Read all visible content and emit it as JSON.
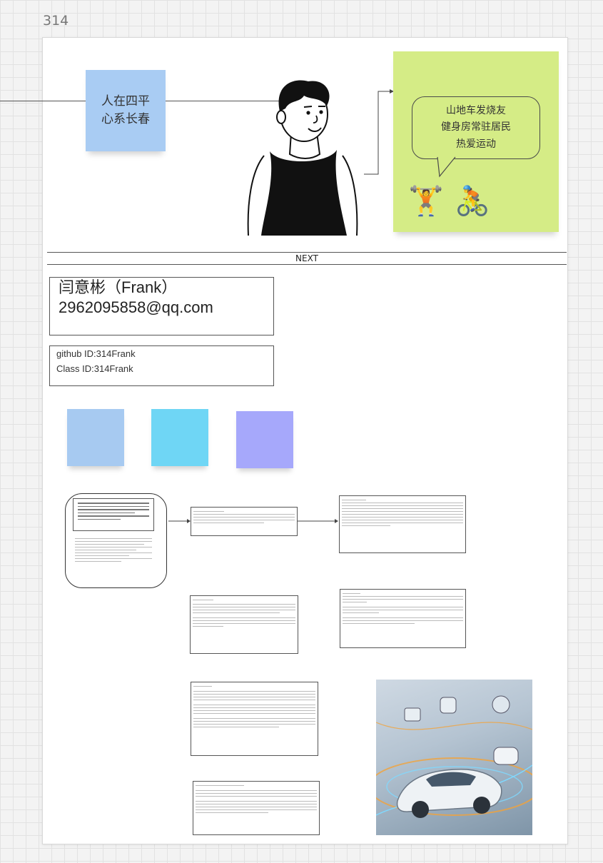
{
  "page_number": "314",
  "sticky_note": {
    "line1": "人在四平",
    "line2": "心系长春"
  },
  "speech_bubble": {
    "line1": "山地车发烧友",
    "line2": "健身房常驻居民",
    "line3": "热爱运动"
  },
  "emojis": {
    "weightlifter": "🏋️",
    "cyclist": "🚴"
  },
  "divider_label": "NEXT",
  "profile": {
    "name": "闫意彬（Frank）",
    "email": "2962095858@qq.com",
    "github": "github ID:314Frank",
    "class_id": "Class  ID:314Frank"
  },
  "colors": {
    "sticky_main": "#a9ccf3",
    "green_panel": "#d5ec86",
    "swatch1": "#a7caf1",
    "swatch2": "#6fd6f5",
    "swatch3": "#a6a8fb"
  }
}
